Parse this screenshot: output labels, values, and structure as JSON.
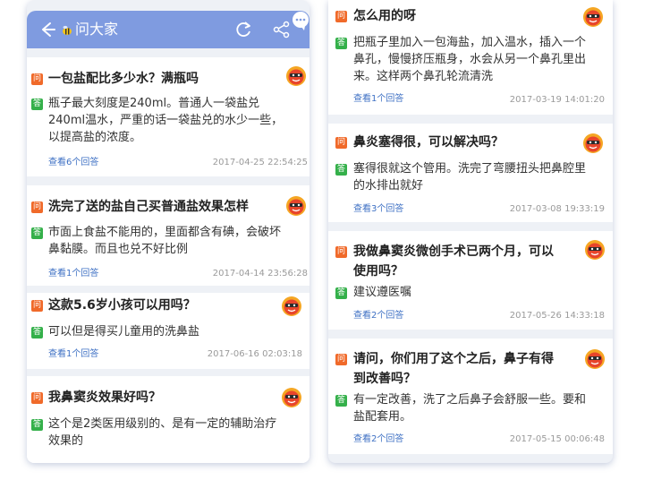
{
  "header": {
    "title": "问大家"
  },
  "badges": {
    "question": "问",
    "answer": "答"
  },
  "left": [
    {
      "q": "一包盐配比多少水？满瓶吗",
      "a": "瓶子最大刻度是240ml。普通人一袋盐兑\n240ml温水，严重的话一袋盐兑的水少一些，\n以提高盐的浓度。",
      "link": "查看6个回答",
      "date": "2017-04-25 22:54:25"
    },
    {
      "q": "洗完了送的盐自己买普通盐效果怎样",
      "a": "市面上食盐不能用的，里面都含有碘，会破坏\n鼻黏膜。而且也兑不好比例",
      "link": "查看1个回答",
      "date": "2017-04-14 23:56:28"
    },
    {
      "q": "这款5.6岁小孩可以用吗？",
      "a": "可以但是得买儿童用的洗鼻盐",
      "link": "查看1个回答",
      "date": "2017-06-16 02:03:18"
    },
    {
      "q": "我鼻窦炎效果好吗？",
      "a": "这个是2类医用级别的、是有一定的辅助治疗\n效果的",
      "link": "",
      "date": ""
    }
  ],
  "right": [
    {
      "q": "怎么用的呀",
      "a": "把瓶子里加入一包海盐，加入温水，插入一个\n鼻孔，慢慢挤压瓶身，水会从另一个鼻孔里出\n来。这样两个鼻孔轮流清洗",
      "link": "查看1个回答",
      "date": "2017-03-19 14:01:20"
    },
    {
      "q": "鼻炎塞得很，可以解决吗？",
      "a": "塞得很就这个管用。洗完了弯腰扭头把鼻腔里\n的水排出就好",
      "link": "查看3个回答",
      "date": "2017-03-08 19:33:19"
    },
    {
      "q": "我做鼻窦炎微创手术已两个月，可以\n使用吗？",
      "a": "建议遵医嘱",
      "link": "查看2个回答",
      "date": "2017-05-26 14:33:18"
    },
    {
      "q": "请问，你们用了这个之后，鼻子有得\n到改善吗？",
      "a": "有一定改善，洗了之后鼻子会舒服一些。要和\n盐配套用。",
      "link": "查看2个回答",
      "date": "2017-05-15 00:06:48"
    }
  ]
}
